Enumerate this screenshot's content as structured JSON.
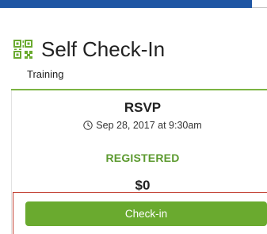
{
  "header": {
    "title": "Self Check-In",
    "subtitle": "Training",
    "icon": "qr-code-icon"
  },
  "rsvp": {
    "title": "RSVP",
    "datetime": "Sep 28, 2017 at 9:30am",
    "datetime_icon": "clock-icon",
    "status": "REGISTERED",
    "price": "$0"
  },
  "actions": {
    "checkin_label": "Check-in"
  },
  "colors": {
    "top_bar": "#1f56a4",
    "accent_green": "#6aaa2f",
    "status_green": "#5c9a2f",
    "highlight_red": "#c0392b"
  }
}
